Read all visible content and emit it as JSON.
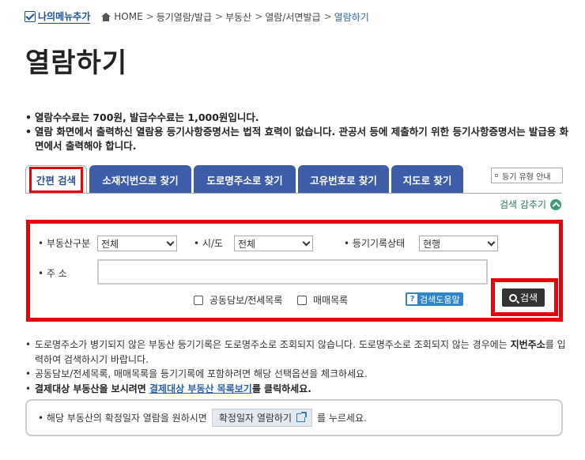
{
  "breadcrumb": {
    "my_menu": "나의메뉴추가",
    "home": "HOME",
    "items": [
      "등기열람/발급",
      "부동산",
      "열람/서면발급"
    ],
    "current": "열람하기",
    "separator": ">"
  },
  "page_title": "열람하기",
  "info_lines": [
    "열람수수료는 700원, 발급수수료는 1,000원입니다.",
    "열람 화면에서 출력하신 열람용 등기사항증명서는 법적 효력이 없습니다. 관공서 등에 제출하기 위한 등기사항증명서는 발급용 화면에서 출력해야 합니다."
  ],
  "tabs": [
    {
      "label": "간편 검색",
      "active": true
    },
    {
      "label": "소재지번으로 찾기"
    },
    {
      "label": "도로명주소로 찾기"
    },
    {
      "label": "고유번호로 찾기"
    },
    {
      "label": "지도로 찾기"
    }
  ],
  "type_guide": "등기 유형 안내",
  "hide_search": "검색 감추기",
  "form": {
    "property_type_label": "부동산구분",
    "property_type_value": "전체",
    "city_label": "시/도",
    "city_value": "전체",
    "status_label": "등기기록상태",
    "status_value": "현행",
    "address_label": "주 소",
    "address_value": "",
    "joint_collateral_label": "공동담보/전세목록",
    "sales_list_label": "매매목록",
    "help_label": "검색도움말",
    "search_button": "검색"
  },
  "notes": {
    "n1_a": "도로명주소가 병기되지 않은 부동산 등기기록은 도로명주소로 조회되지 않습니다. 도로명주소로 조회되지 않는 경우에는 ",
    "n1_b": "지번주소",
    "n1_c": "를 입력하여 검색하시기 바랍니다.",
    "n2": "공동담보/전세목록, 매매목록을 등기기록에 포함하려면 해당 선택옵션을 체크하세요.",
    "n3_a": "결제대상 부동산을 보시려면 ",
    "n3_link": "결제대상 부동산 목록보기",
    "n3_c": "를 클릭하세요."
  },
  "notice": {
    "prefix": "해당 부동산의 확정일자 열람을 원하시면",
    "button": "확정일자 열람하기",
    "suffix": "를 누르세요."
  },
  "colors": {
    "highlight": "#e8000b",
    "tab_bg": "#3e5da8",
    "link": "#2d5fae"
  }
}
